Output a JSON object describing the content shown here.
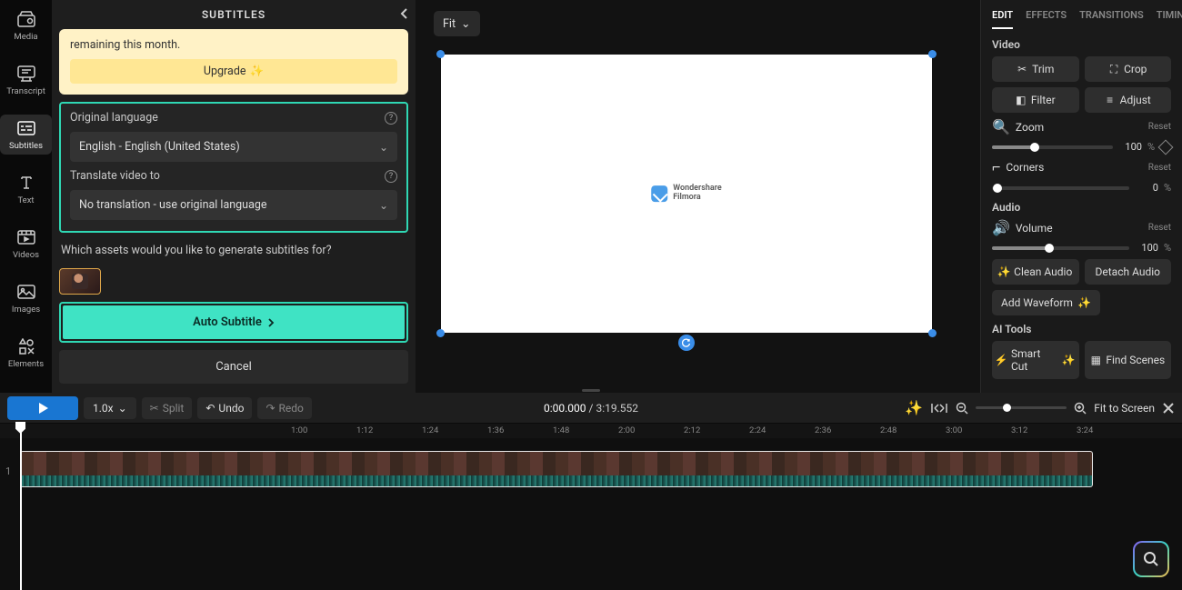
{
  "leftNav": {
    "items": [
      {
        "label": "Media"
      },
      {
        "label": "Transcript"
      },
      {
        "label": "Subtitles"
      },
      {
        "label": "Text"
      },
      {
        "label": "Videos"
      },
      {
        "label": "Images"
      },
      {
        "label": "Elements"
      }
    ]
  },
  "panel": {
    "title": "SUBTITLES",
    "upgrade": {
      "text": "remaining this month.",
      "button": "Upgrade"
    },
    "originalLangLabel": "Original language",
    "originalLangValue": "English - English (United States)",
    "translateLabel": "Translate video to",
    "translateValue": "No translation - use original language",
    "assetsQuestion": "Which assets would you like to generate subtitles for?",
    "autoSubtitle": "Auto Subtitle",
    "cancel": "Cancel"
  },
  "canvas": {
    "fit": "Fit",
    "logoTop": "Wondershare",
    "logoBottom": "Filmora"
  },
  "rightPanel": {
    "tabs": [
      "EDIT",
      "EFFECTS",
      "TRANSITIONS",
      "TIMING"
    ],
    "video": {
      "title": "Video",
      "trim": "Trim",
      "crop": "Crop",
      "filter": "Filter",
      "adjust": "Adjust",
      "zoom": "Zoom",
      "zoomVal": "100",
      "zoomPct": "%",
      "corners": "Corners",
      "cornersVal": "0",
      "cornersPct": "%",
      "reset": "Reset"
    },
    "audio": {
      "title": "Audio",
      "volume": "Volume",
      "volVal": "100",
      "volPct": "%",
      "reset": "Reset",
      "clean": "Clean Audio",
      "detach": "Detach Audio",
      "addWave": "Add Waveform"
    },
    "ai": {
      "title": "AI Tools",
      "smart": "Smart Cut",
      "find": "Find Scenes"
    }
  },
  "timelineBar": {
    "speed": "1.0x",
    "split": "Split",
    "undo": "Undo",
    "redo": "Redo",
    "current": "0:00.000",
    "total": "3:19.552",
    "fit": "Fit to Screen"
  },
  "ruler": [
    "1:00",
    "1:12",
    "1:24",
    "1:36",
    "1:48",
    "2:00",
    "2:12",
    "2:24",
    "2:36",
    "2:48",
    "3:00",
    "3:12",
    "3:24"
  ],
  "trackNum": "1"
}
